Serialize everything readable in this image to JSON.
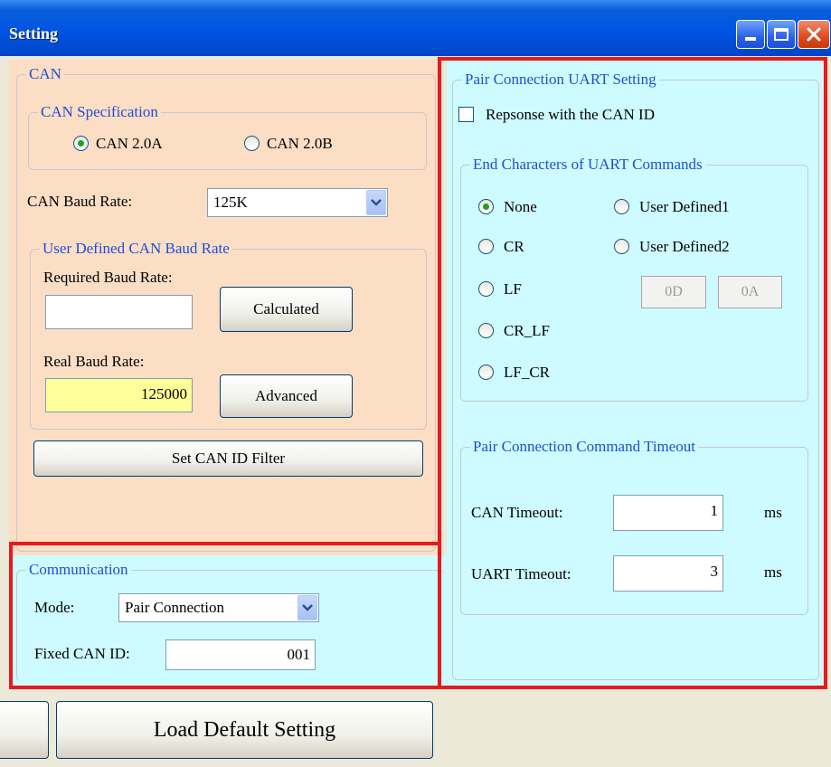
{
  "window": {
    "title": "Setting",
    "buttons": [
      "minimize",
      "maximize",
      "close"
    ]
  },
  "can_panel": {
    "legend": "CAN",
    "spec": {
      "legend": "CAN Specification",
      "options": [
        "CAN 2.0A",
        "CAN 2.0B"
      ],
      "selected": "CAN 2.0A"
    },
    "baud_rate": {
      "label": "CAN Baud Rate:",
      "value": "125K"
    },
    "user_defined": {
      "legend": "User Defined CAN Baud Rate",
      "required_label": "Required Baud Rate:",
      "required_value": "",
      "calculated_button": "Calculated",
      "real_label": "Real Baud Rate:",
      "real_value": "125000",
      "advanced_button": "Advanced"
    },
    "filter_button": "Set CAN ID Filter"
  },
  "communication": {
    "legend": "Communication",
    "mode_label": "Mode:",
    "mode_value": "Pair Connection",
    "fixed_id_label": "Fixed CAN ID:",
    "fixed_id_value": "001"
  },
  "uart_panel": {
    "legend": "Pair Connection UART Setting",
    "response_checkbox": {
      "label": "Repsonse with the CAN ID",
      "checked": false
    },
    "end_chars": {
      "legend": "End Characters of UART Commands",
      "options": [
        "None",
        "CR",
        "LF",
        "CR_LF",
        "LF_CR",
        "User Defined1",
        "User Defined2"
      ],
      "selected": "None",
      "hex_values": [
        "0D",
        "0A"
      ]
    },
    "timeout": {
      "legend": "Pair Connection Command Timeout",
      "can_label": "CAN Timeout:",
      "can_value": "1",
      "uart_label": "UART Timeout:",
      "uart_value": "3",
      "unit": "ms"
    }
  },
  "bottom": {
    "load_default_button": "Load Default Setting"
  },
  "colors": {
    "highlight_red": "#e8191d",
    "peach_panel": "#fcdec5",
    "cyan_panel": "#cdfbff",
    "legend_blue": "#1f4fd6",
    "real_baud_bg": "#ffff99"
  }
}
